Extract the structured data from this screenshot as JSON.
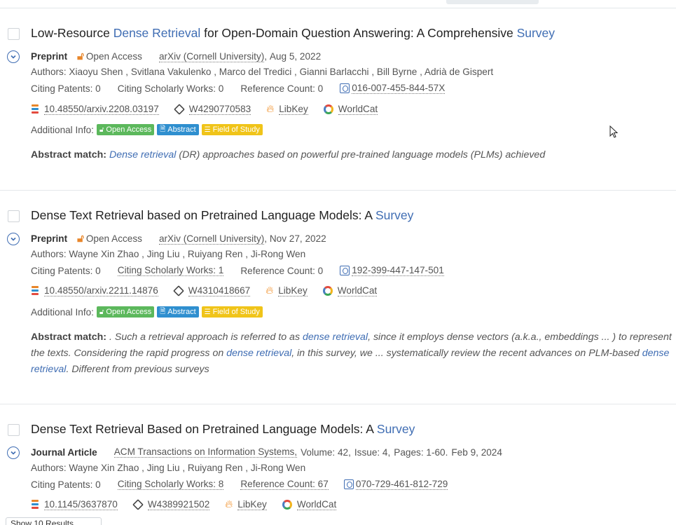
{
  "results": [
    {
      "title_parts": [
        {
          "text": "Low-Resource ",
          "hl": false
        },
        {
          "text": "Dense",
          "hl": true
        },
        {
          "text": " ",
          "hl": false
        },
        {
          "text": "Retrieval",
          "hl": true
        },
        {
          "text": " for Open-Domain Question Answering: A Comprehensive ",
          "hl": false
        },
        {
          "text": "Survey",
          "hl": true
        }
      ],
      "type": "Preprint",
      "open_access": "Open Access",
      "source": "arXiv (Cornell University)",
      "date": "Aug 5, 2022",
      "authors": "Authors: Xiaoyu Shen , Svitlana Vakulenko , Marco del Tredici , Gianni Barlacchi , Bill Byrne , Adrià de Gispert",
      "citing_patents": "Citing Patents: 0",
      "citing_works": "Citing Scholarly Works: 0",
      "reference_count": "Reference Count: 0",
      "lens_id": "016-007-455-844-57X",
      "doi": "10.48550/arxiv.2208.03197",
      "openalex": "W4290770583",
      "libkey": "LibKey",
      "worldcat": "WorldCat",
      "additional_info": "Additional Info:",
      "tags": [
        "Open Access",
        "Abstract",
        "Field of Study"
      ],
      "abstract_label": "Abstract match:",
      "abstract_parts": [
        {
          "text": "Dense",
          "hl": true
        },
        {
          "text": " ",
          "hl": false
        },
        {
          "text": "retrieval",
          "hl": true
        },
        {
          "text": " (DR) approaches based on powerful pre-trained language models (PLMs) achieved",
          "hl": false
        }
      ]
    },
    {
      "title_parts": [
        {
          "text": "Dense Text Retrieval based on Pretrained Language Models: A ",
          "hl": false
        },
        {
          "text": "Survey",
          "hl": true
        }
      ],
      "type": "Preprint",
      "open_access": "Open Access",
      "source": "arXiv (Cornell University)",
      "date": "Nov 27, 2022",
      "authors": "Authors: Wayne Xin Zhao , Jing Liu , Ruiyang Ren , Ji-Rong Wen",
      "citing_patents": "Citing Patents: 0",
      "citing_works": "Citing Scholarly Works: 1",
      "reference_count": "Reference Count: 0",
      "lens_id": "192-399-447-147-501",
      "doi": "10.48550/arxiv.2211.14876",
      "openalex": "W4310418667",
      "libkey": "LibKey",
      "worldcat": "WorldCat",
      "additional_info": "Additional Info:",
      "tags": [
        "Open Access",
        "Abstract",
        "Field of Study"
      ],
      "abstract_label": "Abstract match:",
      "abstract_parts": [
        {
          "text": " . Such a retrieval approach is referred to as ",
          "hl": false
        },
        {
          "text": "dense",
          "hl": true
        },
        {
          "text": " ",
          "hl": false
        },
        {
          "text": "retrieval",
          "hl": true
        },
        {
          "text": ", since it employs dense vectors (a.k.a., embeddings ... ) to represent the texts. Considering the rapid progress on ",
          "hl": false
        },
        {
          "text": "dense",
          "hl": true
        },
        {
          "text": " ",
          "hl": false
        },
        {
          "text": "retrieval",
          "hl": true
        },
        {
          "text": ", in this survey, we ... systematically review the recent advances on PLM-based ",
          "hl": false
        },
        {
          "text": "dense",
          "hl": true
        },
        {
          "text": " ",
          "hl": false
        },
        {
          "text": "retrieval",
          "hl": true
        },
        {
          "text": ". Different from previous surveys",
          "hl": false
        }
      ]
    },
    {
      "title_parts": [
        {
          "text": "Dense Text Retrieval Based on Pretrained Language Models: A ",
          "hl": false
        },
        {
          "text": "Survey",
          "hl": true
        }
      ],
      "type": "Journal Article",
      "source": "ACM Transactions on Information Systems,",
      "volume": "Volume: 42,",
      "issue": "Issue: 4,",
      "pages": "Pages: 1-60.",
      "date": "Feb 9, 2024",
      "authors": "Authors: Wayne Xin Zhao , Jing Liu , Ruiyang Ren , Ji-Rong Wen",
      "citing_patents": "Citing Patents: 0",
      "citing_works": "Citing Scholarly Works: 8",
      "reference_count": "Reference Count: 67",
      "lens_id": "070-729-461-812-729",
      "doi": "10.1145/3637870",
      "openalex": "W4389921502",
      "libkey": "LibKey",
      "worldcat": "WorldCat"
    }
  ],
  "footer": {
    "page_size": "Show 10 Results"
  },
  "colors": {
    "accent": "#3f6db3",
    "tag_green": "#5cb85c",
    "tag_blue": "#2f8fcf",
    "tag_yellow": "#f0c419"
  }
}
